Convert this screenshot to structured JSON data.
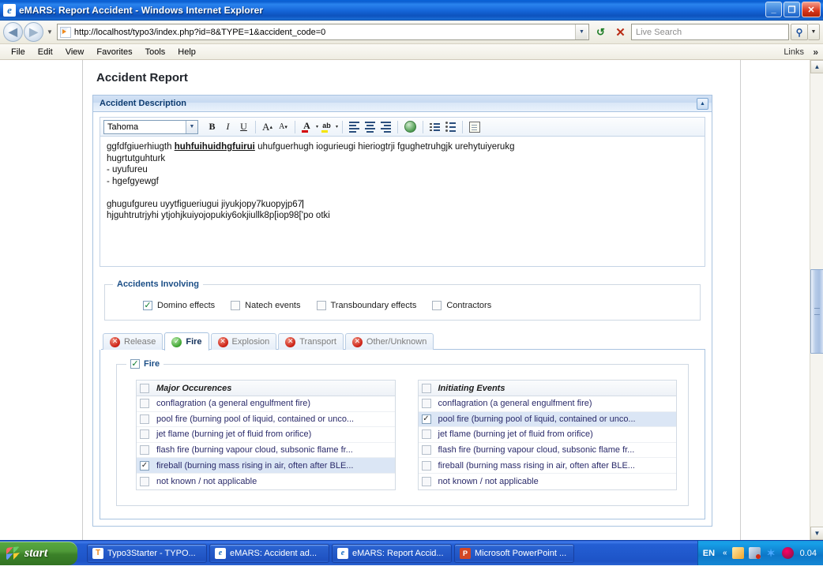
{
  "window": {
    "title": "eMARS: Report Accident - Windows Internet Explorer",
    "app_icon": "ie-logo-icon",
    "minimize_label": "_",
    "maximize_label": "❐",
    "close_label": "✕"
  },
  "nav": {
    "back_label": "◀",
    "forward_label": "▶",
    "history_caret": "▼",
    "url": "http://localhost/typo3/index.php?id=8&TYPE=1&accident_code=0",
    "url_dropdown": "▼",
    "refresh_label": "↺",
    "stop_label": "✕",
    "search_placeholder": "Live Search",
    "search_go": "⚲",
    "search_dropdown": "▼"
  },
  "menubar": {
    "items": [
      "File",
      "Edit",
      "View",
      "Favorites",
      "Tools",
      "Help"
    ],
    "links_label": "Links",
    "chevron": "»"
  },
  "page": {
    "title": "Accident Report"
  },
  "panel": {
    "title": "Accident Description",
    "collapse_label": "▲"
  },
  "rte": {
    "font_family_value": "Tahoma",
    "font_dropdown": "▼",
    "buttons": [
      {
        "name": "bold-button",
        "label": "B"
      },
      {
        "name": "italic-button",
        "label": "I"
      },
      {
        "name": "underline-button",
        "label": "U"
      },
      {
        "name": "increase-font-size-button",
        "label": "A"
      },
      {
        "name": "decrease-font-size-button",
        "label": "A"
      },
      {
        "name": "font-color-button",
        "label": "A"
      },
      {
        "name": "highlight-color-button",
        "label": "ab"
      },
      {
        "name": "align-left-button",
        "label": ""
      },
      {
        "name": "align-center-button",
        "label": ""
      },
      {
        "name": "align-right-button",
        "label": ""
      },
      {
        "name": "insert-link-button",
        "label": ""
      },
      {
        "name": "ordered-list-button",
        "label": ""
      },
      {
        "name": "unordered-list-button",
        "label": ""
      },
      {
        "name": "edit-source-button",
        "label": ""
      }
    ],
    "content": {
      "line1_a": " ggfdfgiuerhiugth ",
      "line1_bold": "huhfuihuidhgfuirui",
      "line1_c": " uhufguerhugh iogurieugi hieriogtrji fgughetruhgjk urehytuiyerukg",
      "line2": "hugrtutguhturk",
      "line3": "- uyufureu",
      "line4": "- hgefgyewgf",
      "line5": "",
      "line6": "ghugufgureu uyytfigueriugui jiyukjopy7kuopyjp67",
      "line7": "hjguhtrutrjyhi ytjohjkuiyojopukiy6okjiullk8p[iop98['po otki"
    }
  },
  "accidents_involving": {
    "legend": "Accidents Involving",
    "options": [
      {
        "label": "Domino effects",
        "checked": true
      },
      {
        "label": "Natech events",
        "checked": false
      },
      {
        "label": "Transboundary effects",
        "checked": false
      },
      {
        "label": "Contractors",
        "checked": false
      }
    ]
  },
  "tabs": [
    {
      "label": "Release",
      "status": "error",
      "icon": "error-circle-icon",
      "glyph": "✕",
      "active": false
    },
    {
      "label": "Fire",
      "status": "ok",
      "icon": "check-circle-icon",
      "glyph": "✓",
      "active": true
    },
    {
      "label": "Explosion",
      "status": "error",
      "icon": "error-circle-icon",
      "glyph": "✕",
      "active": false
    },
    {
      "label": "Transport",
      "status": "error",
      "icon": "error-circle-icon",
      "glyph": "✕",
      "active": false
    },
    {
      "label": "Other/Unknown",
      "status": "error",
      "icon": "error-circle-icon",
      "glyph": "✕",
      "active": false
    }
  ],
  "fire_section": {
    "legend": "Fire",
    "legend_checked": true,
    "columns": [
      {
        "header": "Major Occurences",
        "header_checked": false,
        "rows": [
          {
            "label": "conflagration (a general engulfment fire)",
            "checked": false
          },
          {
            "label": "pool fire (burning pool of liquid, contained or unco...",
            "checked": false
          },
          {
            "label": "jet flame (burning jet of fluid from orifice)",
            "checked": false
          },
          {
            "label": "flash fire (burning vapour cloud, subsonic flame fr...",
            "checked": false
          },
          {
            "label": "fireball (burning mass rising in air, often after BLE...",
            "checked": true
          },
          {
            "label": "not known / not applicable",
            "checked": false
          }
        ]
      },
      {
        "header": "Initiating Events",
        "header_checked": false,
        "rows": [
          {
            "label": "conflagration (a general engulfment fire)",
            "checked": false
          },
          {
            "label": "pool fire (burning pool of liquid, contained or unco...",
            "checked": true
          },
          {
            "label": "jet flame (burning jet of fluid from orifice)",
            "checked": false
          },
          {
            "label": "flash fire (burning vapour cloud, subsonic flame fr...",
            "checked": false
          },
          {
            "label": "fireball (burning mass rising in air, often after BLE...",
            "checked": false
          },
          {
            "label": "not known / not applicable",
            "checked": false
          }
        ]
      }
    ]
  },
  "scrollbar": {
    "up_label": "▲",
    "down_label": "▼"
  },
  "taskbar": {
    "start_label": "start",
    "tasks": [
      {
        "label": "Typo3Starter  - TYPO...",
        "icon": "typo3-icon",
        "glyph": "T"
      },
      {
        "label": "eMARS: Accident ad...",
        "icon": "ie-icon",
        "glyph": "e"
      },
      {
        "label": "eMARS: Report Accid...",
        "icon": "ie-icon",
        "glyph": "e"
      },
      {
        "label": "Microsoft PowerPoint ...",
        "icon": "powerpoint-icon",
        "glyph": "P"
      }
    ],
    "tray": {
      "language": "EN",
      "chevron": "«",
      "icons": [
        "network-icon",
        "connection-icon",
        "bluetooth-icon",
        "opera-icon"
      ],
      "bluetooth_glyph": "✶",
      "clock": "0.04"
    }
  },
  "colors": {
    "titlebar_blue": "#1565d8",
    "panel_header_blue": "#c6daf1",
    "accent_heading": "#1b4e86",
    "selected_row": "#dbe6f5",
    "check_green": "#0a7a2a",
    "error_red": "#cc2014"
  }
}
